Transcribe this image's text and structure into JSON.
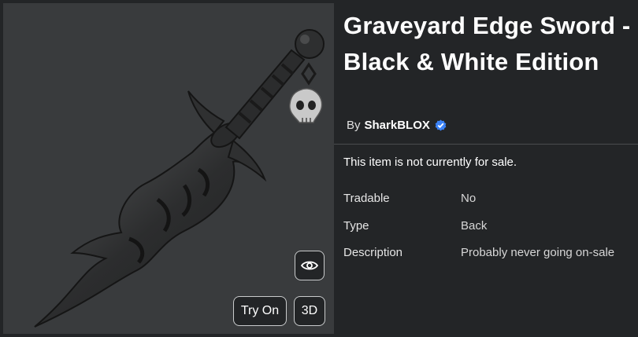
{
  "item": {
    "title": "Graveyard Edge Sword - Black & White Edition",
    "by_label": "By",
    "creator": "SharkBLOX",
    "sale_status": "This item is not currently for sale."
  },
  "details": [
    {
      "label": "Tradable",
      "value": "No"
    },
    {
      "label": "Type",
      "value": "Back"
    },
    {
      "label": "Description",
      "value": "Probably never going on-sale"
    }
  ],
  "preview": {
    "try_on_label": "Try On",
    "three_d_label": "3D",
    "eye_icon": "eye-icon",
    "verified_icon": "verified-badge-icon"
  },
  "colors": {
    "page_bg": "#232527",
    "preview_bg": "#393b3d",
    "verified": "#3b82f6"
  }
}
